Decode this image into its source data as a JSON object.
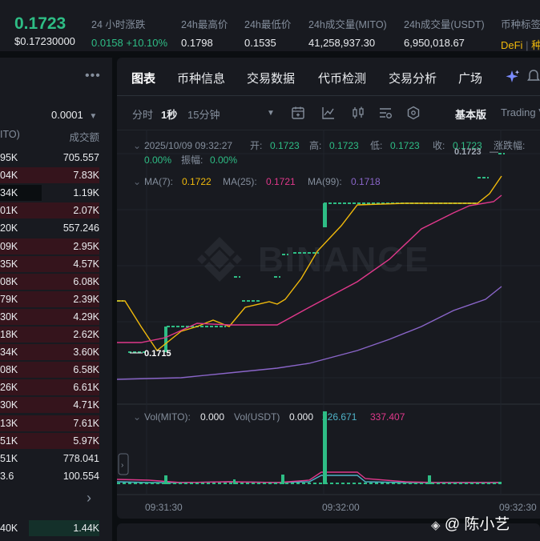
{
  "ticker": {
    "price": "0.1723",
    "fiat_price": "$0.17230000",
    "change_label": "24 小时涨跌",
    "change_value": "0.0158 +10.10%",
    "high_label": "24h最高价",
    "high_value": "0.1798",
    "low_label": "24h最低价",
    "low_value": "0.1535",
    "vol_base_label": "24h成交量(MITO)",
    "vol_base_value": "41,258,937.30",
    "vol_quote_label": "24h成交量(USDT)",
    "vol_quote_value": "6,950,018.67",
    "tags_label": "币种标签",
    "tag_defi": "DeFi",
    "tag_other": "种"
  },
  "book": {
    "menu_icon": "more-horizontal-icon",
    "precision": "0.0001",
    "col_left": "ITO)",
    "col_right": "成交额",
    "rows": [
      {
        "l": "95K",
        "r": "705.557",
        "bg": false
      },
      {
        "l": "04K",
        "r": "7.83K",
        "bg": true
      },
      {
        "l": "34K",
        "r": "1.19K",
        "bg": false
      },
      {
        "l": "01K",
        "r": "2.07K",
        "bg": true
      },
      {
        "l": "20K",
        "r": "557.246",
        "bg": false
      },
      {
        "l": "09K",
        "r": "2.95K",
        "bg": true
      },
      {
        "l": "35K",
        "r": "4.57K",
        "bg": true
      },
      {
        "l": "08K",
        "r": "6.08K",
        "bg": true
      },
      {
        "l": "79K",
        "r": "2.39K",
        "bg": true
      },
      {
        "l": "30K",
        "r": "4.29K",
        "bg": true
      },
      {
        "l": "18K",
        "r": "2.62K",
        "bg": true
      },
      {
        "l": "34K",
        "r": "3.60K",
        "bg": true
      },
      {
        "l": "08K",
        "r": "6.58K",
        "bg": true
      },
      {
        "l": "26K",
        "r": "6.61K",
        "bg": true
      },
      {
        "l": "30K",
        "r": "4.71K",
        "bg": true
      },
      {
        "l": "13K",
        "r": "7.61K",
        "bg": true
      },
      {
        "l": "51K",
        "r": "5.97K",
        "bg": true
      },
      {
        "l": "51K",
        "r": "778.041",
        "bg": false
      },
      {
        "l": "3.6",
        "r": "100.554",
        "bg": false
      }
    ],
    "chevron": "›",
    "bottom_left": "40K",
    "bottom_right": "1.44K"
  },
  "tabs": [
    "图表",
    "币种信息",
    "交易数据",
    "代币检测",
    "交易分析",
    "广场"
  ],
  "toolbar": {
    "time_label": "分时",
    "interval_1s": "1秒",
    "interval_15m": "15分钟",
    "view_basic": "基本版",
    "view_tv": "Trading V"
  },
  "chart": {
    "ohlc_datetime": "2025/10/09 09:32:27",
    "open_label": "开:",
    "open_value": "0.1723",
    "high_label": "高:",
    "high_value": "0.1723",
    "low_label": "低:",
    "low_value": "0.1723",
    "close_label": "收:",
    "close_value": "0.1723",
    "change_label": "涨跌幅:",
    "change_value": "0.00%",
    "amp_label": "振幅:",
    "amp_value": "0.00%",
    "ma7_label": "MA(7):",
    "ma7_value": "0.1722",
    "ma25_label": "MA(25):",
    "ma25_value": "0.1721",
    "ma99_label": "MA(99):",
    "ma99_value": "0.1718",
    "last_price_marker": "0.1723",
    "low_marker": "0.1715",
    "watermark": "BINANCE",
    "vol_base_label": "Vol(MITO):",
    "vol_base_value": "0.000",
    "vol_quote_label": "Vol(USDT)",
    "vol_quote_value": "0.000",
    "vol_ma1": "226.671",
    "vol_ma2": "337.407",
    "time_labels": [
      "09:31:30",
      "09:32:00",
      "09:32:30"
    ],
    "colors": {
      "up": "#2ebd85",
      "ma7": "#f0b90b",
      "ma25": "#e0388b",
      "ma99": "#8a65c9",
      "vol_ma1": "#4fb3c8",
      "vol_ma2": "#e0388b"
    }
  },
  "footer": {
    "watermark_author": "@ 陈小艺"
  }
}
